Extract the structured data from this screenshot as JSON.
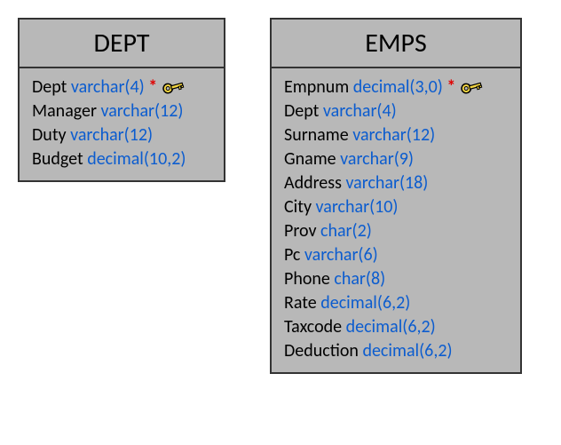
{
  "tables": [
    {
      "id": "dept",
      "title": "DEPT",
      "columns": [
        {
          "name": "Dept",
          "type": "varchar(4)",
          "pk": true
        },
        {
          "name": "Manager",
          "type": "varchar(12)",
          "pk": false
        },
        {
          "name": "Duty",
          "type": "varchar(12)",
          "pk": false
        },
        {
          "name": "Budget",
          "type": "decimal(10,2)",
          "pk": false
        }
      ]
    },
    {
      "id": "emps",
      "title": "EMPS",
      "columns": [
        {
          "name": "Empnum",
          "type": "decimal(3,0)",
          "pk": true
        },
        {
          "name": "Dept",
          "type": "varchar(4)",
          "pk": false
        },
        {
          "name": "Surname",
          "type": "varchar(12)",
          "pk": false
        },
        {
          "name": "Gname",
          "type": "varchar(9)",
          "pk": false
        },
        {
          "name": "Address",
          "type": "varchar(18)",
          "pk": false
        },
        {
          "name": "City",
          "type": "varchar(10)",
          "pk": false
        },
        {
          "name": "Prov",
          "type": "char(2)",
          "pk": false
        },
        {
          "name": "Pc",
          "type": "varchar(6)",
          "pk": false
        },
        {
          "name": "Phone",
          "type": "char(8)",
          "pk": false
        },
        {
          "name": "Rate",
          "type": "decimal(6,2)",
          "pk": false
        },
        {
          "name": "Taxcode",
          "type": "decimal(6,2)",
          "pk": false
        },
        {
          "name": "Deduction",
          "type": "decimal(6,2)",
          "pk": false
        }
      ]
    }
  ],
  "star": "*"
}
